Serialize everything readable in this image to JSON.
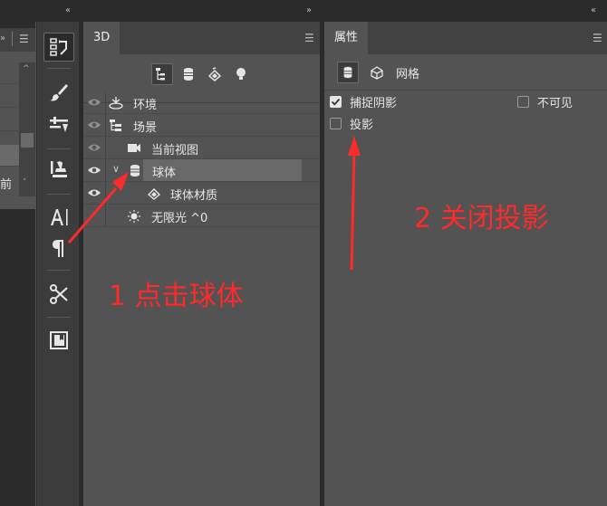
{
  "panels": {
    "scene": {
      "tab": "3D",
      "rows": [
        {
          "label": "环境",
          "icon": "environment-icon"
        },
        {
          "label": "场景",
          "icon": "scene-icon"
        },
        {
          "label": "当前视图",
          "icon": "camera-icon"
        },
        {
          "label": "球体",
          "icon": "mesh-icon",
          "selected": true
        },
        {
          "label": "球体材质",
          "icon": "material-icon"
        },
        {
          "label": "无限光 ^0",
          "icon": "infinite-light-icon"
        }
      ]
    },
    "properties": {
      "tab": "属性",
      "mode": "网格",
      "catch_shadow": "捕捉阴影",
      "invisible": "不可见",
      "cast_shadow": "投影",
      "catch_shadow_checked": true,
      "invisible_checked": false,
      "cast_shadow_checked": false
    },
    "leftpanel": {
      "partial_text": "前"
    }
  },
  "annotations": {
    "step1": "1 点击球体",
    "step2": "2 关闭投影",
    "color": "#ff2a2a"
  },
  "colors": {
    "panel": "#535353",
    "dark": "#2b2b2b",
    "selected_row": "#686868"
  }
}
